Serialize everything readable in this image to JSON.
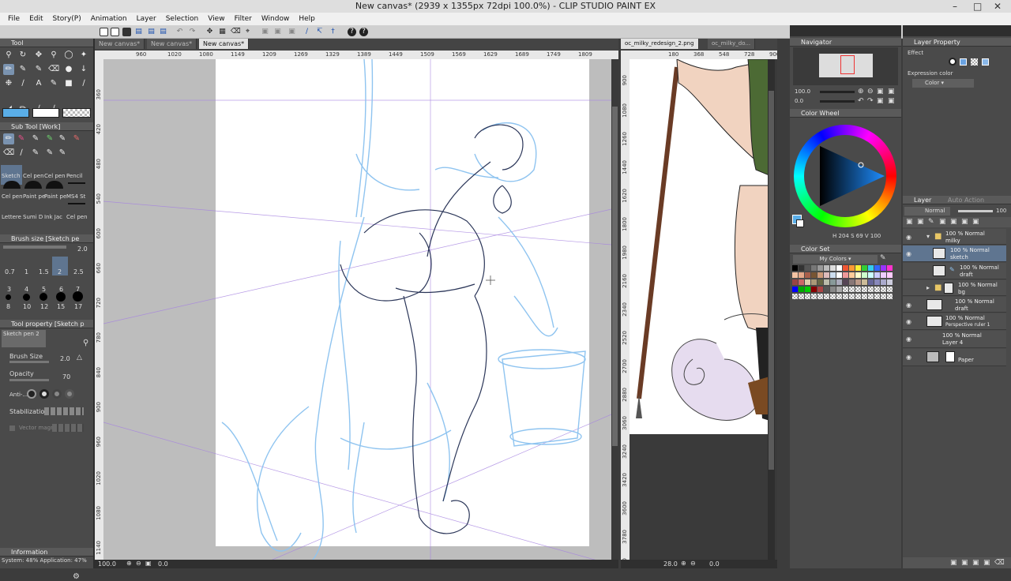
{
  "app": {
    "title": "New canvas* (2939 x 1355px 72dpi 100.0%)  - CLIP STUDIO PAINT EX"
  },
  "menu": [
    "File",
    "Edit",
    "Story(P)",
    "Animation",
    "Layer",
    "Selection",
    "View",
    "Filter",
    "Window",
    "Help"
  ],
  "tabs": {
    "main": [
      "New canvas*",
      "New canvas*",
      "New canvas*"
    ],
    "secondary": [
      "oc_milky_redesign_2.png",
      "oc_milky_do..."
    ]
  },
  "ruler_main_top": [
    "960",
    "1020",
    "1080",
    "1149",
    "1209",
    "1269",
    "1329",
    "1389",
    "1449",
    "1509",
    "1569",
    "1629",
    "1689",
    "1749",
    "1809"
  ],
  "ruler_main_left": [
    "360",
    "420",
    "480",
    "540",
    "600",
    "660",
    "720",
    "780",
    "840",
    "900",
    "960",
    "1020",
    "1080",
    "1140",
    "1200"
  ],
  "ruler_sec_top": [
    "180",
    "368",
    "548",
    "728",
    "900"
  ],
  "ruler_sec_left": [
    "900",
    "1080",
    "1260",
    "1440",
    "1620",
    "1800",
    "1980",
    "2160",
    "2340",
    "2520",
    "2700",
    "2880",
    "3060",
    "3240",
    "3420",
    "3600",
    "3780",
    "3960"
  ],
  "tool_panel": {
    "title": "Tool",
    "subtool_title": "Sub Tool [Work]",
    "brushes": [
      "Sketch",
      "Cel pen",
      "Cel pen",
      "Pencil",
      "Cel pen",
      "Paint pe",
      "Paint pe",
      "MS4 St",
      "Lettere",
      "Sumi D",
      "Ink Jac",
      "Cel pen"
    ]
  },
  "brush_size": {
    "title": "Brush size [Sketch pe",
    "value": "2.0",
    "sizes": [
      "0.7",
      "1",
      "1.5",
      "2",
      "2.5",
      "3",
      "4",
      "5",
      "6",
      "7",
      "8",
      "10",
      "12",
      "15",
      "17"
    ]
  },
  "tool_property": {
    "title": "Tool property [Sketch p",
    "preset_name": "Sketch pen 2",
    "brush_size_label": "Brush Size",
    "brush_size_value": "2.0",
    "opacity_label": "Opacity",
    "opacity_value": "70",
    "antialias_label": "Anti-...",
    "stabilization_label": "Stabilization",
    "vector_magnet_label": "Vector magnet"
  },
  "information": {
    "title": "Information",
    "status": "System: 48%   Application: 47%"
  },
  "status_bar": {
    "main_zoom": "100.0",
    "main_angle": "0.0",
    "sec_zoom": "28.0",
    "sec_angle": "0.0"
  },
  "navigator": {
    "title": "Navigator",
    "zoom": "100.0",
    "angle": "0.0"
  },
  "color_wheel": {
    "title": "Color Wheel",
    "hsv": "H 204  S 69  V 100"
  },
  "color_set": {
    "title": "Color Set",
    "set_name": "My Colors"
  },
  "layer_property": {
    "title": "Layer Property",
    "effect_label": "Effect",
    "expression_label": "Expression color",
    "expression_value": "Color"
  },
  "layer_panel": {
    "title": "Layer",
    "tab2": "Auto Action",
    "blend_mode": "Normal",
    "opacity": "100",
    "layers": [
      {
        "line1": "100 %  Normal",
        "line2": "milky"
      },
      {
        "line1": "100 %  Normal",
        "line2": "sketch"
      },
      {
        "line1": "100 %  Normal",
        "line2": "draft"
      },
      {
        "line1": "100 %  Normal",
        "line2": "bg"
      },
      {
        "line1": "100 %  Normal",
        "line2": "draft"
      },
      {
        "line1": "100 %  Normal",
        "line2": "Perspective ruler 1"
      },
      {
        "line1": "100 %  Normal",
        "line2": "Layer 4"
      },
      {
        "line1": "",
        "line2": "Paper"
      }
    ]
  },
  "colors": {
    "accent": "#7a93b0",
    "main_color": "#5aaee8",
    "sketch_blue": "#8fc4f0",
    "panel_bg": "#4a4a4a"
  }
}
